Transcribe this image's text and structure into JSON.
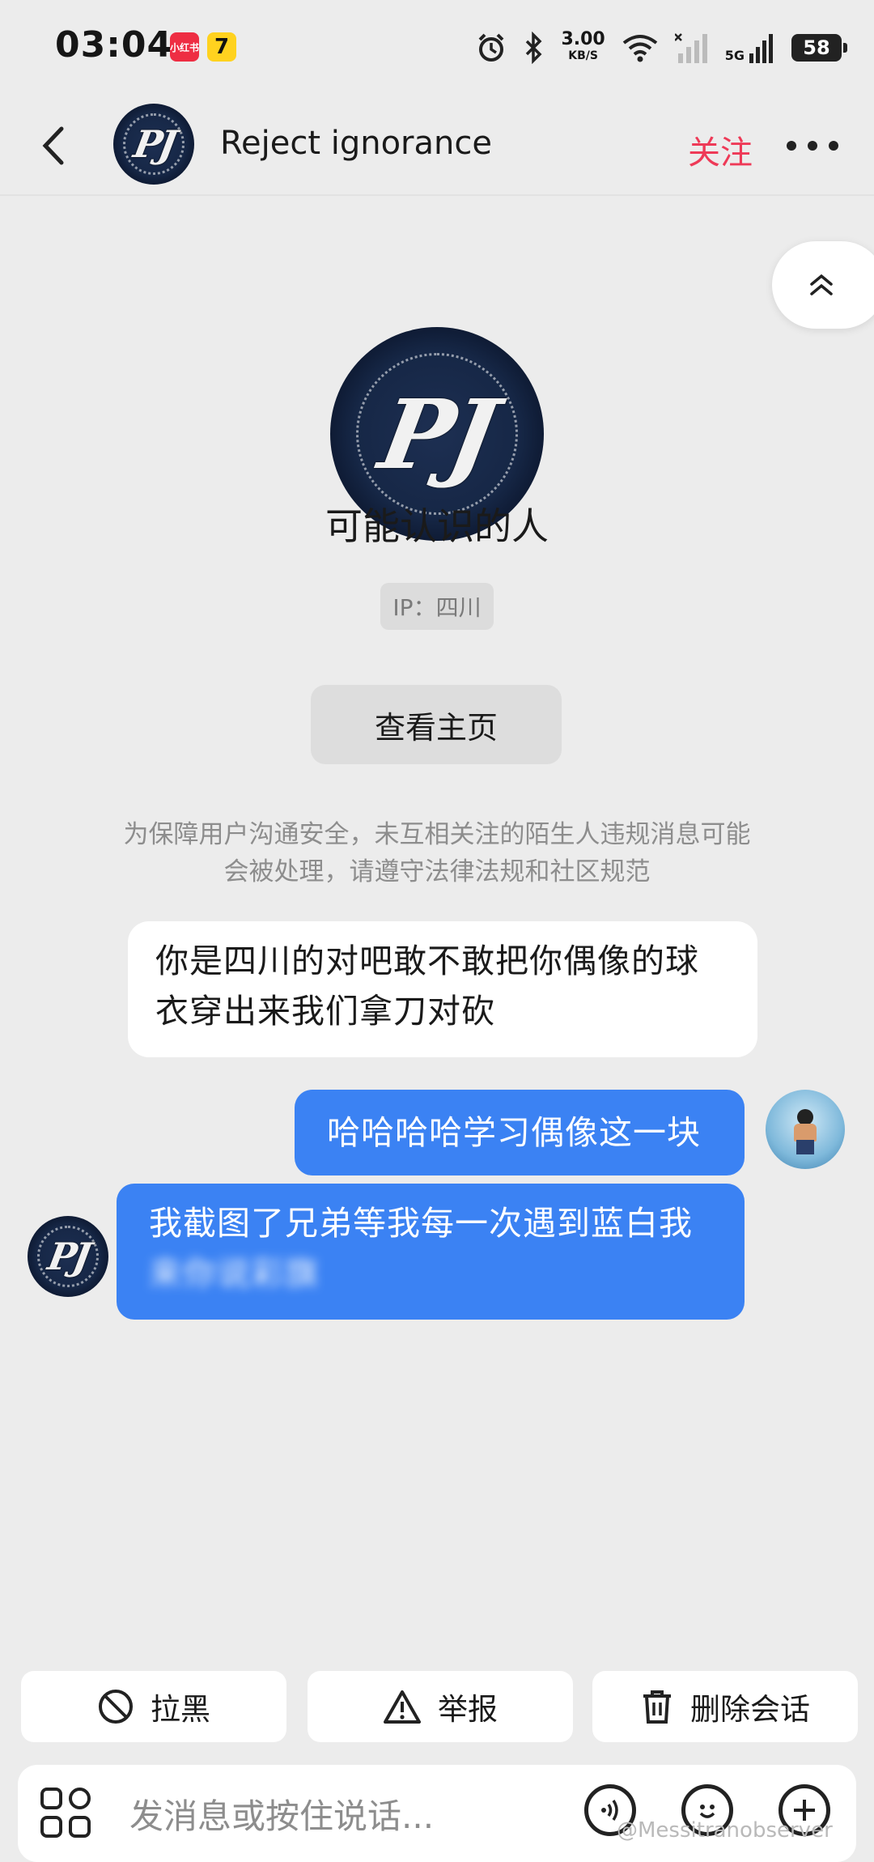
{
  "status_bar": {
    "time": "03:04",
    "app_badge_1": "小红书",
    "app_badge_2": "7",
    "net_speed": "3.00",
    "net_unit": "KB/S",
    "network": "5G",
    "battery": "58"
  },
  "header": {
    "title": "Reject ignorance",
    "follow_label": "关注",
    "avatar_monogram": "PJ"
  },
  "profile": {
    "avatar_monogram": "PJ",
    "label": "可能认识的人",
    "ip": "IP：四川",
    "view_button": "查看主页"
  },
  "notice": "为保障用户沟通安全，未互相关注的陌生人违规消息可能会被处理，请遵守法律法规和社区规范",
  "messages": [
    {
      "side": "left",
      "text": "你是四川的对吧敢不敢把你偶像的球衣穿出来我们拿刀对砍"
    },
    {
      "side": "right",
      "text": "哈哈哈哈学习偶像这一块"
    },
    {
      "side": "right",
      "text": "我截图了兄弟等我每一次遇到蓝白我",
      "blurred_text": "来你说彩旗"
    }
  ],
  "actions": {
    "block": "拉黑",
    "report": "举报",
    "delete": "删除会话"
  },
  "input": {
    "placeholder": "发消息或按住说话..."
  },
  "watermark": "@Messitranobserver",
  "colors": {
    "accent_follow": "#ee3a57",
    "bubble_out": "#3b82f3",
    "background": "#ececec"
  },
  "icons": [
    "back-arrow-icon",
    "more-dots-icon",
    "collapse-up-icon",
    "block-icon",
    "warning-icon",
    "trash-icon",
    "apps-grid-icon",
    "voice-icon",
    "emoji-icon",
    "plus-icon"
  ]
}
